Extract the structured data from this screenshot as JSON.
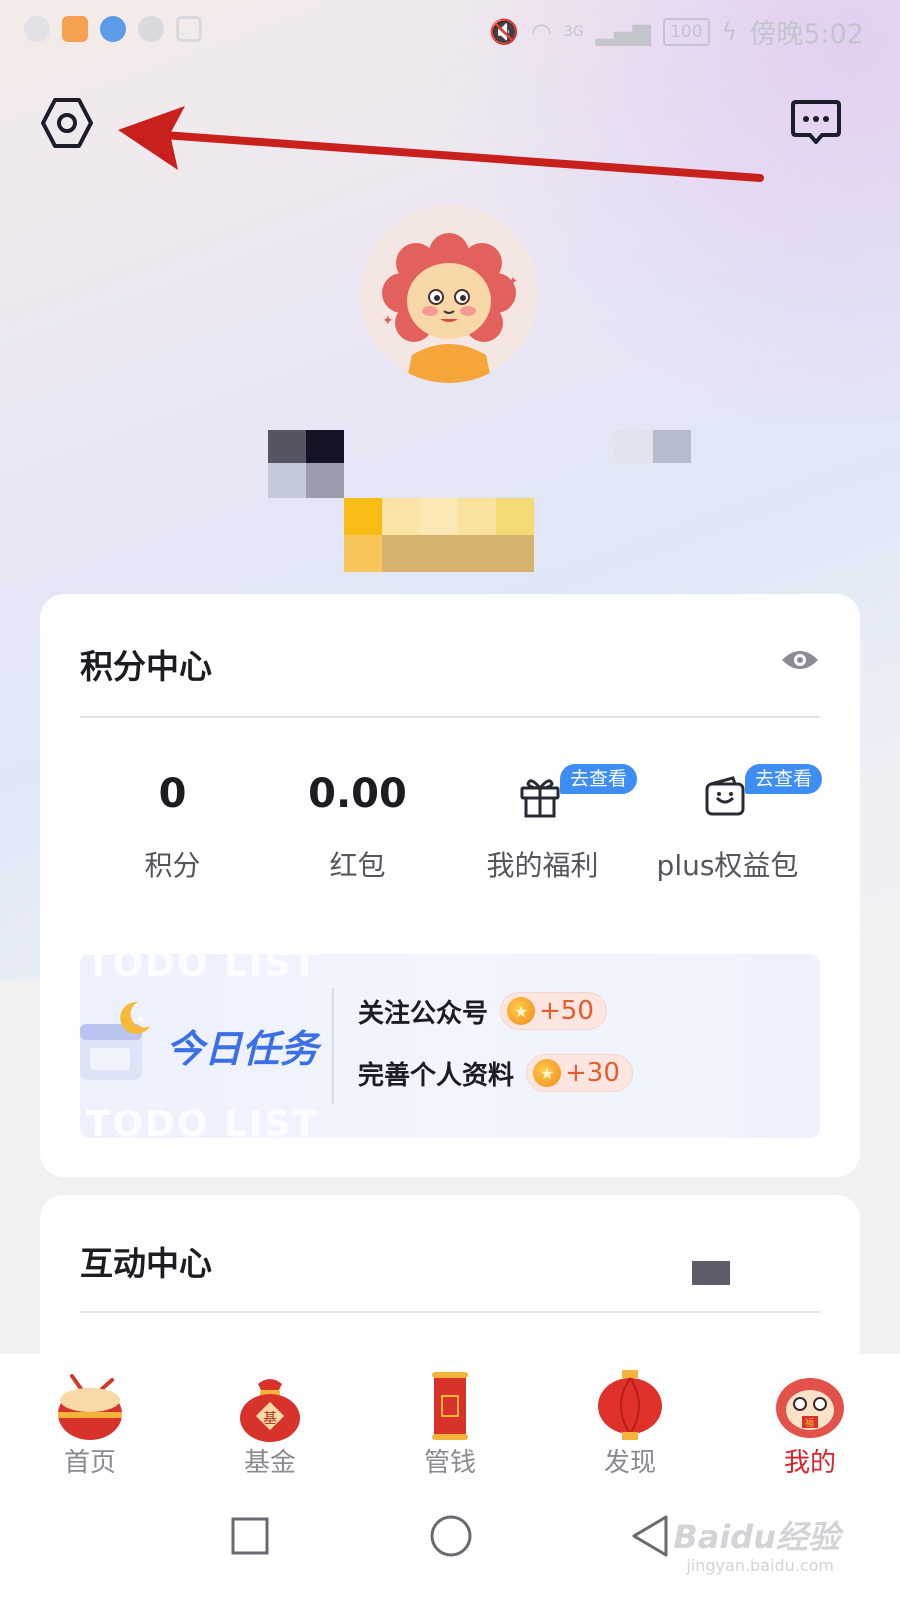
{
  "status_bar": {
    "network": "3G",
    "battery": "100",
    "time": "傍晚5:02"
  },
  "points_center": {
    "title": "积分中心",
    "stats": [
      {
        "value": "0",
        "label": "积分"
      },
      {
        "value": "0.00",
        "label": "红包"
      },
      {
        "label": "我的福利",
        "badge": "去查看"
      },
      {
        "label": "plus权益包",
        "badge": "去查看"
      }
    ],
    "daily_tasks": {
      "watermark": "TODO LIST",
      "title": "今日任务",
      "items": [
        {
          "name": "关注公众号",
          "reward": "+50"
        },
        {
          "name": "完善个人资料",
          "reward": "+30"
        }
      ]
    }
  },
  "interaction_center": {
    "title": "互动中心"
  },
  "bottom_nav": {
    "items": [
      {
        "label": "首页"
      },
      {
        "label": "基金"
      },
      {
        "label": "管钱"
      },
      {
        "label": "发现"
      },
      {
        "label": "我的",
        "active": true
      }
    ]
  },
  "watermark": {
    "brand": "Baidu经验",
    "url": "jingyan.baidu.com"
  },
  "colors": {
    "accent_blue": "#3e8df5",
    "active_red": "#d8232a",
    "annotation_arrow": "#c8201c"
  },
  "icons": [
    "settings-icon",
    "message-icon",
    "eye-icon",
    "gift-icon",
    "wallet-icon",
    "calendar-moon-icon",
    "coin-icon",
    "drum-icon",
    "money-bag-icon",
    "scroll-icon",
    "lantern-icon",
    "lion-icon"
  ]
}
